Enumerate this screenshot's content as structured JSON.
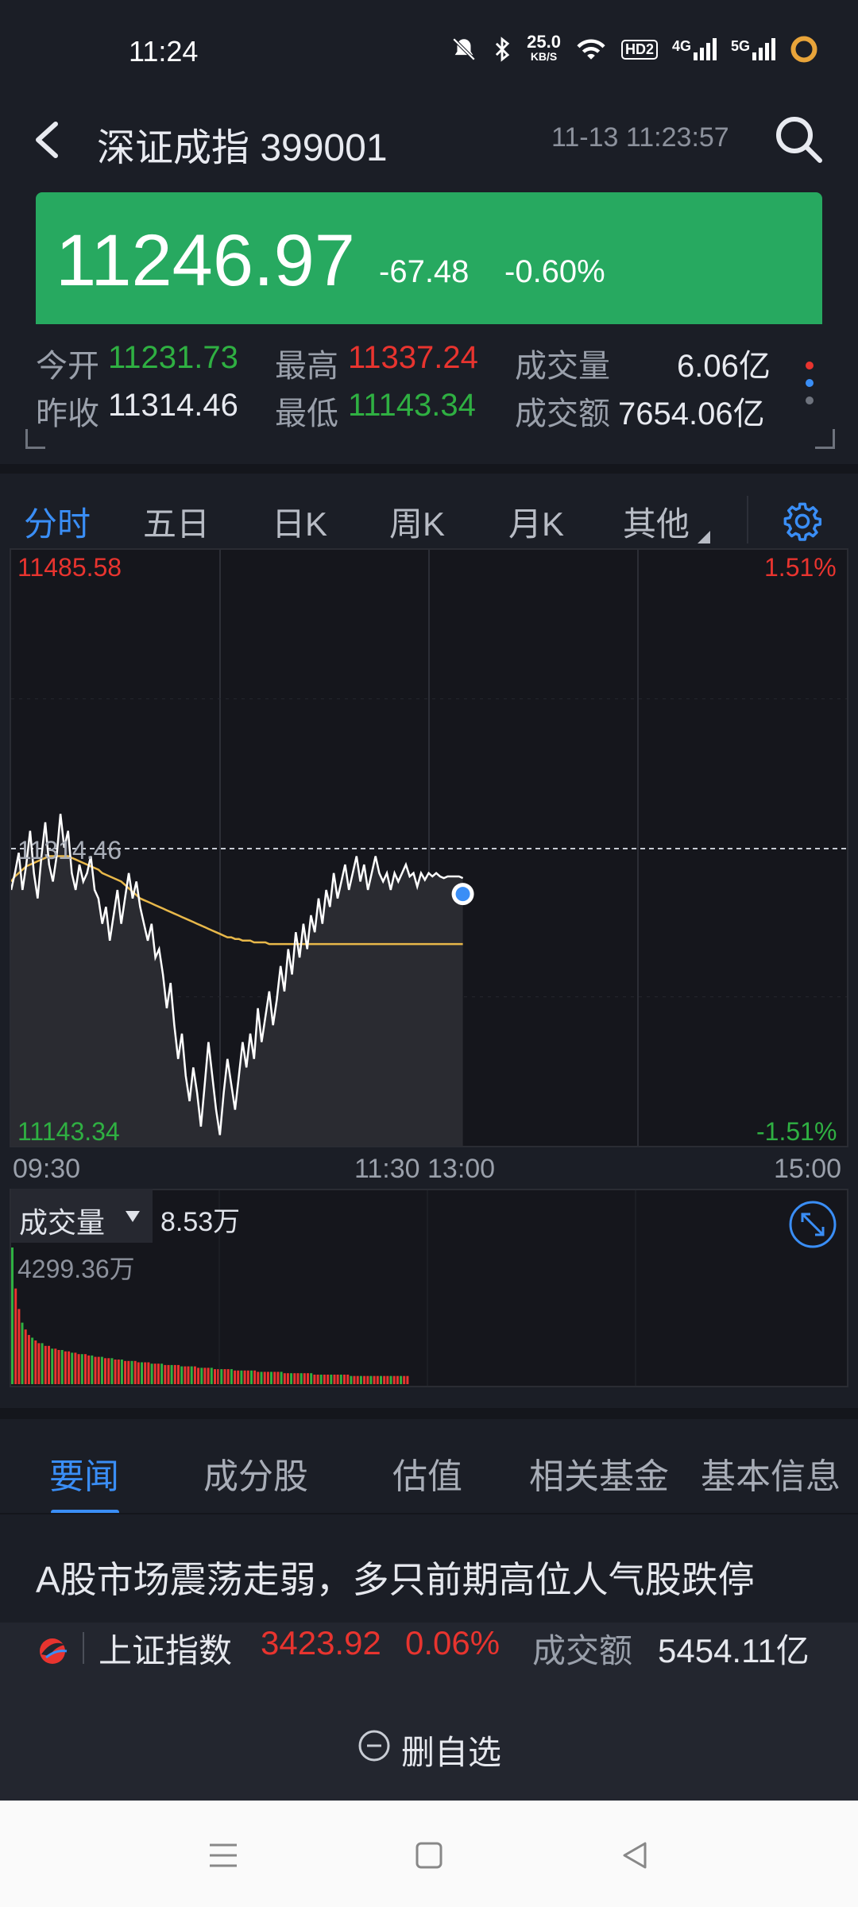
{
  "status_bar": {
    "time": "11:24",
    "net_speed_value": "25.0",
    "net_speed_unit": "KB/S",
    "hd_badge": "HD2",
    "signal_4g": "4G",
    "signal_5g": "5G",
    "icons": [
      "mute-icon",
      "bluetooth-icon",
      "wifi-icon",
      "hd-voice-icon",
      "signal-4g-icon",
      "signal-5g-icon",
      "battery-ring-icon"
    ]
  },
  "header": {
    "title": "深证成指 399001",
    "datetime": "11-13 11:23:57"
  },
  "quote": {
    "price": "11246.97",
    "change": "-67.48",
    "change_pct": "-0.60%",
    "box_color": "#27a960"
  },
  "stats": {
    "open_label": "今开",
    "open_value": "11231.73",
    "high_label": "最高",
    "high_value": "11337.24",
    "volume_label": "成交量",
    "volume_value": "6.06亿",
    "prev_close_label": "昨收",
    "prev_close_value": "11314.46",
    "low_label": "最低",
    "low_value": "11143.34",
    "turnover_label": "成交额",
    "turnover_value": "7654.06亿"
  },
  "period_tabs": [
    {
      "label": "分时",
      "active": true
    },
    {
      "label": "五日",
      "active": false
    },
    {
      "label": "日K",
      "active": false
    },
    {
      "label": "周K",
      "active": false
    },
    {
      "label": "月K",
      "active": false
    },
    {
      "label": "其他",
      "active": false
    }
  ],
  "chart_data": {
    "type": "line",
    "y_max_label": "11485.58",
    "y_min_label": "11143.34",
    "ref_label": "11314.46",
    "pct_max_label": "1.51%",
    "pct_min_label": "-1.51%",
    "ylim": [
      11143.34,
      11485.58
    ],
    "reference": 11314.46,
    "x_ticks": [
      "09:30",
      "11:30 13:00",
      "15:00"
    ],
    "total_minutes": 240,
    "series": [
      {
        "values": [
          11290,
          11300,
          11312,
          11290,
          11305,
          11325,
          11300,
          11285,
          11310,
          11330,
          11305,
          11295,
          11310,
          11335,
          11315,
          11325,
          11300,
          11290,
          11305,
          11295,
          11300,
          11310,
          11290,
          11285,
          11270,
          11280,
          11260,
          11275,
          11290,
          11270,
          11285,
          11300,
          11285,
          11295,
          11280,
          11270,
          11260,
          11270,
          11250,
          11255,
          11240,
          11220,
          11235,
          11210,
          11190,
          11205,
          11180,
          11165,
          11185,
          11170,
          11150,
          11175,
          11200,
          11180,
          11160,
          11145,
          11170,
          11190,
          11175,
          11160,
          11180,
          11200,
          11185,
          11205,
          11190,
          11220,
          11200,
          11215,
          11230,
          11210,
          11225,
          11245,
          11230,
          11255,
          11240,
          11265,
          11250,
          11270,
          11255,
          11275,
          11265,
          11285,
          11270,
          11290,
          11280,
          11300,
          11285,
          11295,
          11305,
          11290,
          11300,
          11310,
          11295,
          11305,
          11290,
          11300,
          11310,
          11300,
          11295,
          11300,
          11290,
          11300,
          11295,
          11300,
          11305,
          11298,
          11300,
          11292,
          11300,
          11296,
          11300,
          11298,
          11300,
          11298,
          11297,
          11298,
          11298,
          11298,
          11298,
          11297
        ]
      },
      {
        "values": [
          11295,
          11298,
          11300,
          11302,
          11304,
          11305,
          11306,
          11307,
          11308,
          11309,
          11310,
          11310,
          11310,
          11310,
          11310,
          11310,
          11309,
          11308,
          11307,
          11306,
          11305,
          11304,
          11303,
          11302,
          11300,
          11299,
          11298,
          11297,
          11296,
          11295,
          11293,
          11291,
          11289,
          11287,
          11285,
          11284,
          11283,
          11282,
          11281,
          11280,
          11279,
          11278,
          11277,
          11276,
          11275,
          11274,
          11273,
          11272,
          11271,
          11270,
          11269,
          11268,
          11267,
          11266,
          11265,
          11264,
          11263,
          11262,
          11262,
          11261,
          11261,
          11260,
          11260,
          11260,
          11259,
          11259,
          11259,
          11259,
          11258,
          11258,
          11258,
          11258,
          11258,
          11258,
          11258,
          11258,
          11258,
          11258,
          11258,
          11258,
          11258,
          11258,
          11258,
          11258,
          11258,
          11258,
          11258,
          11258,
          11258,
          11258,
          11258,
          11258,
          11258,
          11258,
          11258,
          11258,
          11258,
          11258,
          11258,
          11258,
          11258,
          11258,
          11258,
          11258,
          11258,
          11258,
          11258,
          11258,
          11258,
          11258,
          11258,
          11258,
          11258,
          11258,
          11258,
          11258,
          11258,
          11258,
          11258,
          11258
        ]
      }
    ],
    "grid": true
  },
  "volume": {
    "label": "成交量",
    "current_value": "8.53万",
    "max_label": "4299.36万",
    "bars": [
      100,
      70,
      55,
      45,
      40,
      36,
      34,
      32,
      30,
      30,
      28,
      28,
      26,
      26,
      25,
      25,
      24,
      24,
      23,
      23,
      22,
      22,
      22,
      21,
      21,
      20,
      20,
      20,
      19,
      19,
      19,
      18,
      18,
      18,
      17,
      17,
      17,
      17,
      16,
      16,
      16,
      16,
      15,
      15,
      15,
      15,
      14,
      14,
      14,
      14,
      14,
      13,
      13,
      13,
      13,
      13,
      12,
      12,
      12,
      12,
      12,
      11,
      11,
      11,
      11,
      11,
      11,
      10,
      10,
      10,
      10,
      10,
      10,
      10,
      9,
      9,
      9,
      9,
      9,
      9,
      9,
      9,
      8,
      8,
      8,
      8,
      8,
      8,
      8,
      8,
      8,
      7,
      7,
      7,
      7,
      7,
      7,
      7,
      7,
      7,
      7,
      7,
      6,
      6,
      6,
      6,
      6,
      6,
      6,
      6,
      6,
      6,
      6,
      6,
      6,
      6,
      6,
      6,
      6,
      6
    ],
    "bar_colors_up": "#e8342f",
    "bar_colors_down": "#2fb042"
  },
  "bottom_tabs": [
    {
      "label": "要闻",
      "active": true
    },
    {
      "label": "成分股",
      "active": false
    },
    {
      "label": "估值",
      "active": false
    },
    {
      "label": "相关基金",
      "active": false
    },
    {
      "label": "基本信息",
      "active": false
    }
  ],
  "news": {
    "headline": "A股市场震荡走弱，多只前期高位人气股跌停"
  },
  "ticker": {
    "name": "上证指数",
    "value": "3423.92",
    "pct": "0.06%",
    "turnover_label": "成交额",
    "turnover_value": "5454.11亿"
  },
  "actions": {
    "delete_label": "删自选"
  }
}
